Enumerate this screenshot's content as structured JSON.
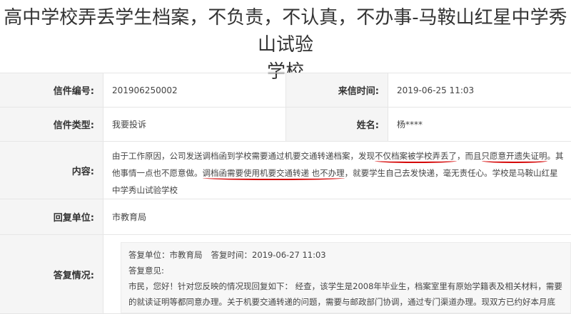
{
  "page": {
    "title_line1": "高中学校弄丢学生档案，不负责，不认真，不办事-马鞍山红星中学秀山试验",
    "title_line2": "学校"
  },
  "fields": {
    "letter_no_label": "信件编号:",
    "letter_no": "201906250002",
    "date_label": "来信时间:",
    "date": "2019-06-25 11:03",
    "type_label": "信件类型:",
    "type": "我要投诉",
    "name_label": "姓名:",
    "name": "杨****",
    "content_label": "内容:",
    "content_part1": "由于工作原因，公司发送调档函到学校需要通过机要交通转递档案，发现",
    "content_mark1": "不仅档案被学校弄丢了",
    "content_part2": "，而且",
    "content_mark2": "只愿意开遗失证明",
    "content_part3": "。其他事情一点也不愿意做。",
    "content_mark3": "调档函需要使用机要交通转递 也不办理",
    "content_part4": "，就要学生自己去发快递，毫无责任心。学校是马鞍山红星中学秀山试验学校",
    "unit_label": "回复单位:",
    "unit": "市教育局",
    "reply_label": "答复情况:"
  },
  "reply": {
    "unit_label": "答复单位：市教育局",
    "time_label": "答复时间：2019-06-27 11:03",
    "opinion_label": "答复意见:",
    "body": "市民，您好！针对您反映的情况现回复如下： 经查，该学生是2008年毕业生，档案室里有原始学籍表及相关材料，需要的就读证明等都同意办理。关于机要交通转递的问题，需要与邮政部门协调，通过专门渠道办理。现双方已约好本月底来校协商处理。如有疑问请联系红星秀"
  },
  "colors": {
    "label_bg": "#f5f5f5",
    "border": "#e6e6e6",
    "underline": "#d40000"
  }
}
